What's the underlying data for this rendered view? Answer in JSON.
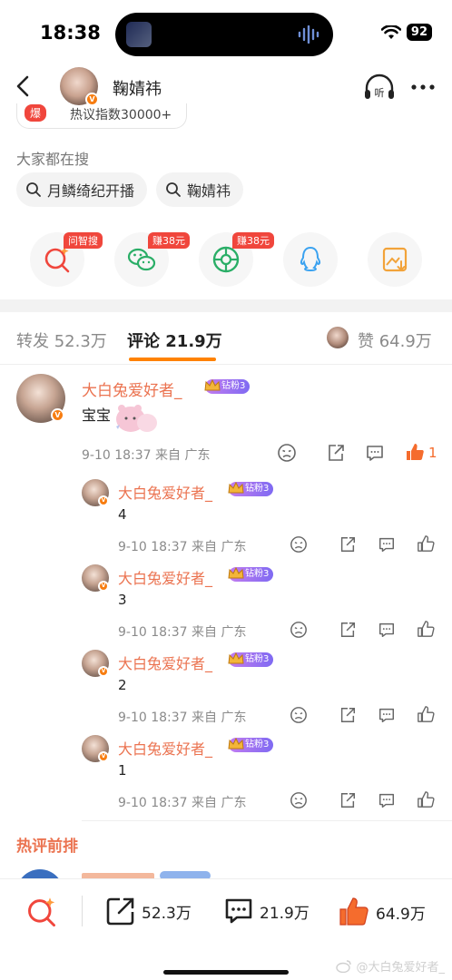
{
  "status_bar": {
    "time": "18:38",
    "battery": "92"
  },
  "nav": {
    "title": "鞠婧祎",
    "listen_label": "听"
  },
  "hot_tag": {
    "badge": "爆",
    "text": "热议指数30000+"
  },
  "everyone_searching": {
    "label": "大家都在搜",
    "chips": [
      "月鳞绮纪开播",
      "鞠婧祎"
    ]
  },
  "share_row": {
    "badges": [
      "问智搜",
      "赚38元",
      "赚38元"
    ]
  },
  "tabs": {
    "repost": "转发 52.3万",
    "comments": "评论 21.9万",
    "likes": "赞 64.9万"
  },
  "main_comment": {
    "username": "大白兔爱好者_",
    "fan_badge": "钻粉3",
    "text": "宝宝",
    "meta": "9-10 18:37 来自 广东",
    "like_count": "1"
  },
  "replies": [
    {
      "username": "大白兔爱好者_",
      "fan_badge": "钻粉3",
      "text": "4",
      "meta": "9-10 18:37 来自 广东"
    },
    {
      "username": "大白兔爱好者_",
      "fan_badge": "钻粉3",
      "text": "3",
      "meta": "9-10 18:37 来自 广东"
    },
    {
      "username": "大白兔爱好者_",
      "fan_badge": "钻粉3",
      "text": "2",
      "meta": "9-10 18:37 来自 广东"
    },
    {
      "username": "大白兔爱好者_",
      "fan_badge": "钻粉3",
      "text": "1",
      "meta": "9-10 18:37 来自 广东"
    }
  ],
  "hot_section": {
    "heading": "热评前排"
  },
  "bottom_bar": {
    "repost": "52.3万",
    "comments": "21.9万",
    "likes": "64.9万"
  },
  "watermark": "@大白兔爱好者_",
  "colors": {
    "accent": "#ff8200",
    "name": "#eb7350",
    "badge_red": "#f0463c"
  }
}
